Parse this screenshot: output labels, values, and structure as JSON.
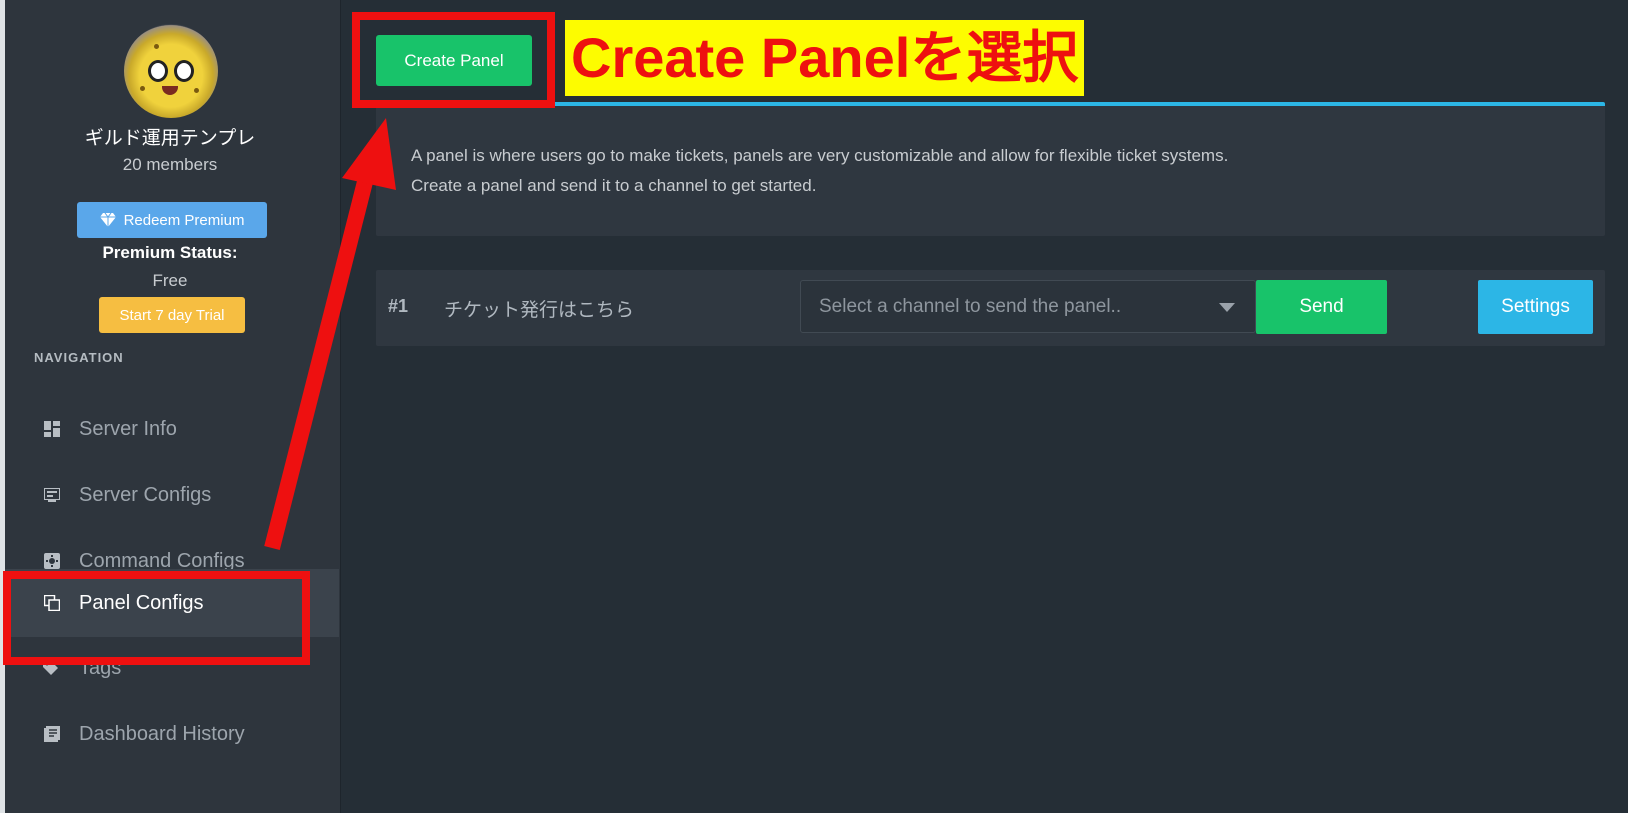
{
  "sidebar": {
    "server_name": "ギルド運用テンプレ",
    "members": "20 members",
    "redeem_premium_label": "Redeem Premium",
    "premium_status_label": "Premium Status:",
    "premium_status_value": "Free",
    "trial_button_label": "Start 7 day Trial",
    "nav_heading": "NAVIGATION",
    "nav_items": [
      {
        "label": "Server Info",
        "icon": "dashboard-icon"
      },
      {
        "label": "Server Configs",
        "icon": "server-icon"
      },
      {
        "label": "Command Configs",
        "icon": "command-icon"
      },
      {
        "label": "Panel Configs",
        "icon": "copy-icon",
        "active": true
      },
      {
        "label": "Tags",
        "icon": "tag-icon"
      },
      {
        "label": "Dashboard History",
        "icon": "history-icon"
      }
    ]
  },
  "main": {
    "create_panel_label": "Create Panel",
    "info_line1": "A panel is where users go to make tickets, panels are very customizable and allow for flexible ticket systems.",
    "info_line2": "Create a panel and send it to a channel to get started.",
    "panels": [
      {
        "number": "#1",
        "name": "チケット発行はこちら",
        "channel_placeholder": "Select a channel to send the panel..",
        "send_label": "Send",
        "settings_label": "Settings"
      }
    ]
  },
  "annotation": {
    "text": "Create Panelを選択",
    "text_color": "#ee1010",
    "background": "#fdfc00",
    "box_color": "#ee1010"
  },
  "colors": {
    "accent_green": "#18c36a",
    "accent_blue": "#2cb6e6",
    "premium_blue": "#5aa7ea",
    "trial_yellow": "#f6be41"
  }
}
